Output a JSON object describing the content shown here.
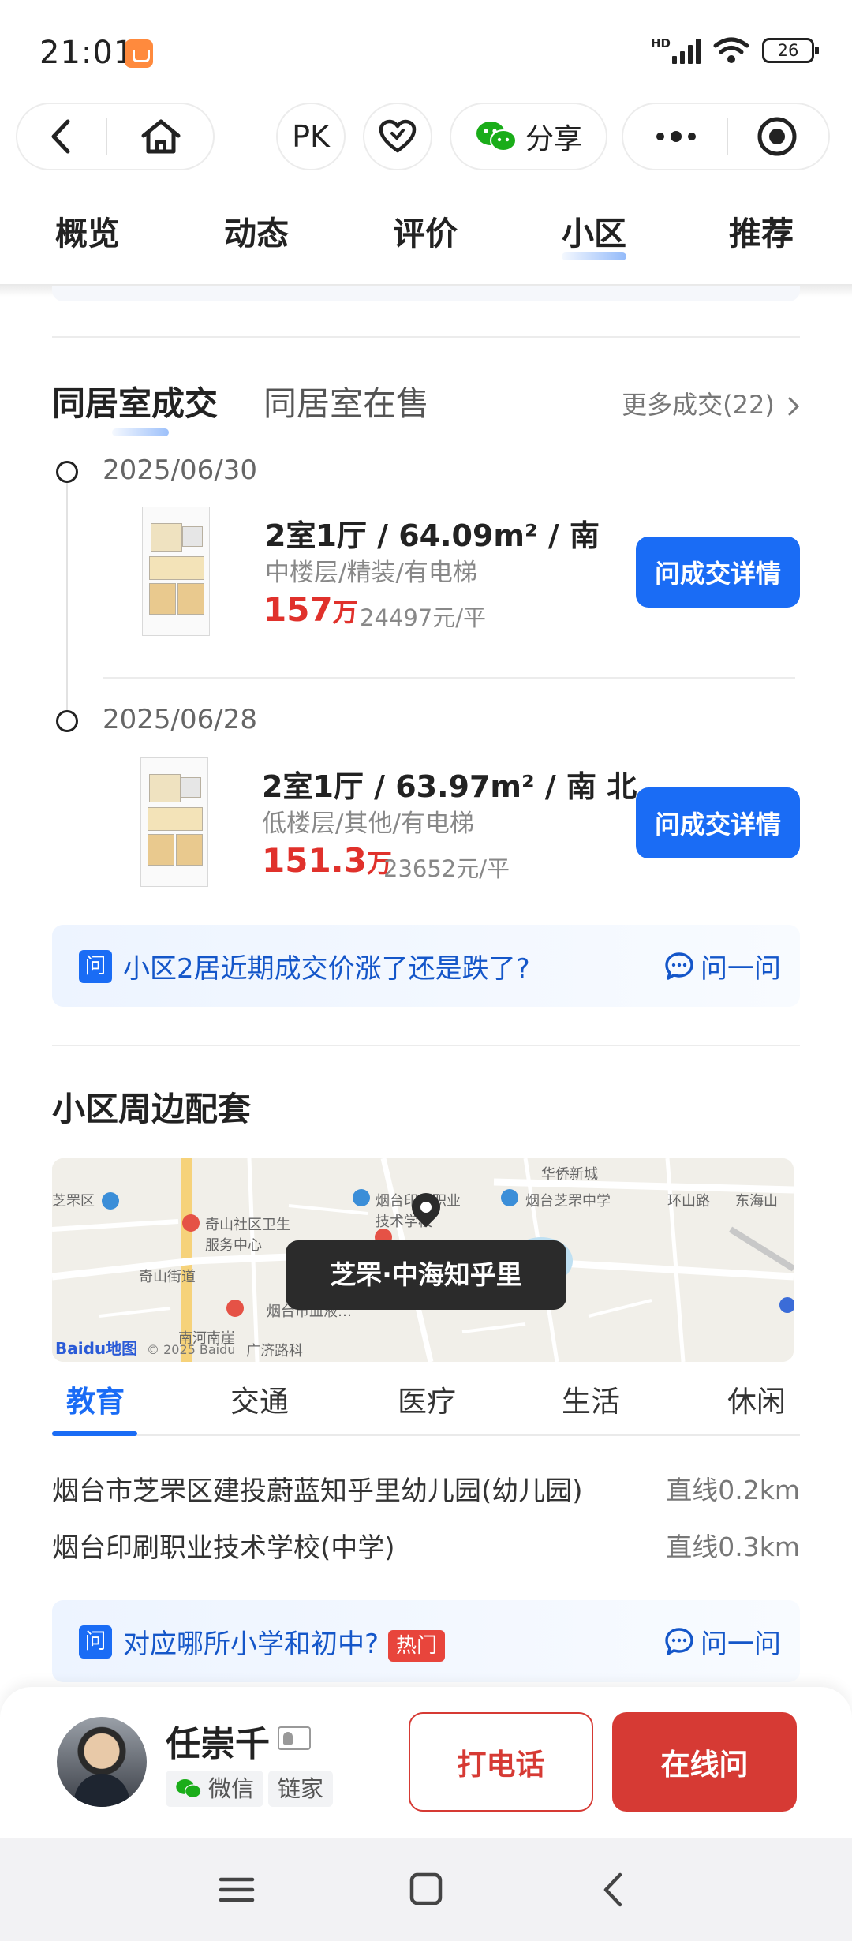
{
  "status_bar": {
    "time": "21:01",
    "network": "HD",
    "battery": "26"
  },
  "header": {
    "pk_label": "PK",
    "share_label": "分享"
  },
  "tabs": [
    {
      "label": "概览",
      "active": false
    },
    {
      "label": "动态",
      "active": false
    },
    {
      "label": "评价",
      "active": false
    },
    {
      "label": "小区",
      "active": true
    },
    {
      "label": "推荐",
      "active": false
    }
  ],
  "deals": {
    "tab_sold": "同居室成交",
    "tab_onsale": "同居室在售",
    "more_link": "更多成交(22)",
    "items": [
      {
        "date": "2025/06/30",
        "title": "2室1厅 / 64.09m² / 南",
        "sub": "中楼层/精装/有电梯",
        "price": "157",
        "price_unit": "万",
        "unit_price": "24497元/平",
        "button": "问成交详情"
      },
      {
        "date": "2025/06/28",
        "title": "2室1厅 / 63.97m² / 南 北",
        "sub": "低楼层/其他/有电梯",
        "price": "151.3",
        "price_unit": "万",
        "unit_price": "23652元/平",
        "button": "问成交详情"
      }
    ],
    "ask": {
      "tag": "问",
      "text": "小区2居近期成交价涨了还是跌了?",
      "action": "问一问"
    }
  },
  "surroundings": {
    "title": "小区周边配套",
    "map": {
      "label": "芝罘·中海知乎里",
      "places": [
        "华侨新城",
        "烟台印刷职业技术学校",
        "烟台芝罘中学",
        "奇山社区卫生服务中心",
        "奇山街道",
        "环山路",
        "南河南崖",
        "烟台市血液…",
        "芝罘区",
        "广济路科",
        "东海山"
      ],
      "logo": "Baidu地图",
      "copyright": "© 2025 Baidu"
    },
    "categories": [
      {
        "label": "教育",
        "active": true
      },
      {
        "label": "交通",
        "active": false
      },
      {
        "label": "医疗",
        "active": false
      },
      {
        "label": "生活",
        "active": false
      },
      {
        "label": "休闲",
        "active": false
      }
    ],
    "pois": [
      {
        "name": "烟台市芝罘区建投蔚蓝知乎里幼儿园(幼儿园)",
        "distance": "直线0.2km"
      },
      {
        "name": "烟台印刷职业技术学校(中学)",
        "distance": "直线0.3km"
      }
    ],
    "ask": {
      "tag": "问",
      "text": "对应哪所小学和初中?",
      "hot": "热门",
      "action": "问一问"
    }
  },
  "agent": {
    "name": "任崇千",
    "tag_wechat": "微信",
    "tag_company": "链家",
    "call_label": "打电话",
    "chat_label": "在线问"
  },
  "colors": {
    "primary_blue": "#1a6cf5",
    "price_red": "#e0312b",
    "action_red": "#d63a34"
  }
}
